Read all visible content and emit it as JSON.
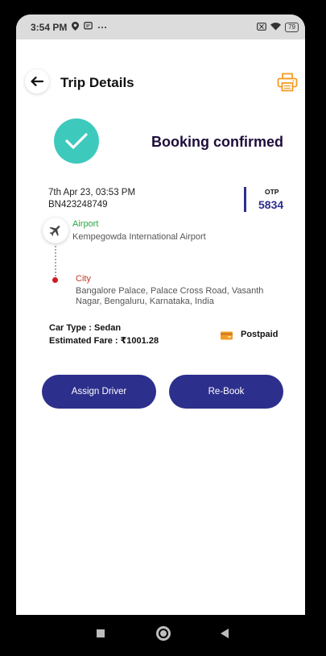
{
  "status_bar": {
    "time": "3:54 PM",
    "ellipsis": "···",
    "battery": "79"
  },
  "header": {
    "title": "Trip Details"
  },
  "booking": {
    "status_text": "Booking confirmed",
    "datetime": "7th Apr 23, 03:53 PM",
    "booking_id": "BN423248749",
    "otp_label": "OTP",
    "otp_value": "5834"
  },
  "route": {
    "pickup_label": "Airport",
    "pickup_address": "Kempegowda International Airport",
    "drop_label": "City",
    "drop_address": "Bangalore Palace, Palace Cross Road, Vasanth Nagar, Bengaluru, Karnataka, India"
  },
  "trip_info": {
    "car_type": "Car Type : Sedan",
    "estimated_fare": "Estimated Fare : ₹1001.28",
    "payment_mode": "Postpaid"
  },
  "actions": {
    "assign_driver": "Assign Driver",
    "rebook": "Re-Book"
  },
  "colors": {
    "primary": "#2d2f8c",
    "success_circle": "#3ec9bd",
    "pickup_label": "#28a745",
    "drop_label": "#c0392b",
    "printer_icon": "#f39c24"
  }
}
